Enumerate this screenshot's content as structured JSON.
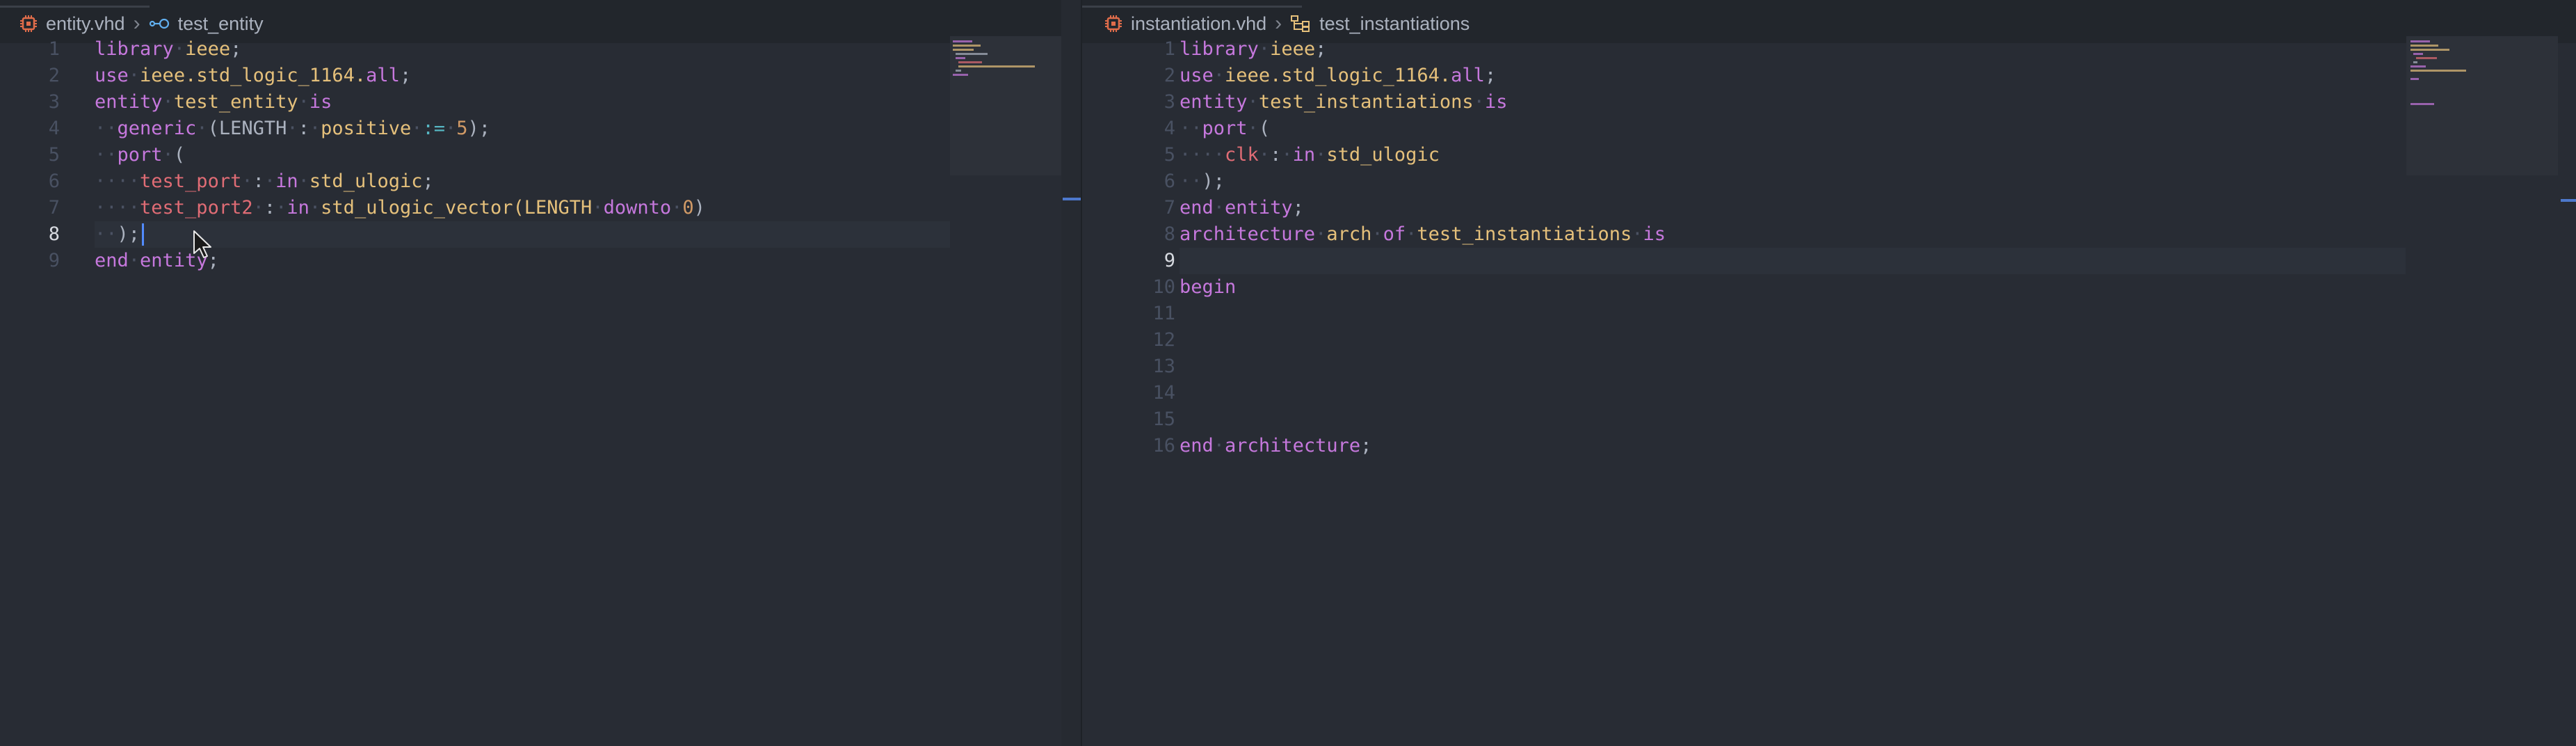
{
  "left_pane": {
    "breadcrumb": {
      "file": "entity.vhd",
      "symbol": "test_entity"
    },
    "line_numbers": [
      "1",
      "2",
      "3",
      "4",
      "5",
      "6",
      "7",
      "8",
      "9"
    ],
    "active_line": "8",
    "lines": [
      [
        {
          "t": "library",
          "c": "kw"
        },
        {
          "t": "·",
          "c": "ws"
        },
        {
          "t": "ieee",
          "c": "id"
        },
        {
          "t": ";",
          "c": ""
        }
      ],
      [
        {
          "t": "use",
          "c": "kw"
        },
        {
          "t": "·",
          "c": "ws"
        },
        {
          "t": "ieee.std_logic_1164.",
          "c": "id"
        },
        {
          "t": "all",
          "c": "kw"
        },
        {
          "t": ";",
          "c": ""
        }
      ],
      [
        {
          "t": "entity",
          "c": "kw"
        },
        {
          "t": "·",
          "c": "ws"
        },
        {
          "t": "test_entity",
          "c": "id"
        },
        {
          "t": "·",
          "c": "ws"
        },
        {
          "t": "is",
          "c": "kw"
        }
      ],
      [
        {
          "t": "··",
          "c": "ws"
        },
        {
          "t": "generic",
          "c": "kw"
        },
        {
          "t": "·",
          "c": "ws"
        },
        {
          "t": "(LENGTH",
          "c": ""
        },
        {
          "t": "·",
          "c": "ws"
        },
        {
          "t": ":",
          "c": ""
        },
        {
          "t": "·",
          "c": "ws"
        },
        {
          "t": "positive",
          "c": "id"
        },
        {
          "t": "·",
          "c": "ws"
        },
        {
          "t": ":=",
          "c": "op"
        },
        {
          "t": "·",
          "c": "ws"
        },
        {
          "t": "5",
          "c": "num"
        },
        {
          "t": ");",
          "c": ""
        }
      ],
      [
        {
          "t": "··",
          "c": "ws"
        },
        {
          "t": "port",
          "c": "kw"
        },
        {
          "t": "·",
          "c": "ws"
        },
        {
          "t": "(",
          "c": ""
        }
      ],
      [
        {
          "t": "····",
          "c": "ws"
        },
        {
          "t": "test_port",
          "c": "sg"
        },
        {
          "t": "·",
          "c": "ws"
        },
        {
          "t": ":",
          "c": ""
        },
        {
          "t": "·",
          "c": "ws"
        },
        {
          "t": "in",
          "c": "kw"
        },
        {
          "t": "·",
          "c": "ws"
        },
        {
          "t": "std_ulogic",
          "c": "id"
        },
        {
          "t": ";",
          "c": ""
        }
      ],
      [
        {
          "t": "····",
          "c": "ws"
        },
        {
          "t": "test_port2",
          "c": "sg"
        },
        {
          "t": "·",
          "c": "ws"
        },
        {
          "t": ":",
          "c": ""
        },
        {
          "t": "·",
          "c": "ws"
        },
        {
          "t": "in",
          "c": "kw"
        },
        {
          "t": "·",
          "c": "ws"
        },
        {
          "t": "std_ulogic_vector(LENGTH",
          "c": "id"
        },
        {
          "t": "·",
          "c": "ws"
        },
        {
          "t": "downto",
          "c": "kw"
        },
        {
          "t": "·",
          "c": "ws"
        },
        {
          "t": "0",
          "c": "num"
        },
        {
          "t": ")",
          "c": ""
        }
      ],
      [
        {
          "t": "··",
          "c": "ws"
        },
        {
          "t": ");",
          "c": ""
        }
      ],
      [
        {
          "t": "end",
          "c": "kw"
        },
        {
          "t": "·",
          "c": "ws"
        },
        {
          "t": "entity",
          "c": "kw"
        },
        {
          "t": ";",
          "c": ""
        }
      ]
    ]
  },
  "right_pane": {
    "breadcrumb": {
      "file": "instantiation.vhd",
      "symbol": "test_instantiations"
    },
    "line_numbers": [
      "1",
      "2",
      "3",
      "4",
      "5",
      "6",
      "7",
      "8",
      "9",
      "10",
      "11",
      "12",
      "13",
      "14",
      "15",
      "16"
    ],
    "active_line": "9",
    "lines": [
      [
        {
          "t": "library",
          "c": "kw"
        },
        {
          "t": "·",
          "c": "ws"
        },
        {
          "t": "ieee",
          "c": "id"
        },
        {
          "t": ";",
          "c": ""
        }
      ],
      [
        {
          "t": "use",
          "c": "kw"
        },
        {
          "t": "·",
          "c": "ws"
        },
        {
          "t": "ieee.std_logic_1164.",
          "c": "id"
        },
        {
          "t": "all",
          "c": "kw"
        },
        {
          "t": ";",
          "c": ""
        }
      ],
      [
        {
          "t": "entity",
          "c": "kw"
        },
        {
          "t": "·",
          "c": "ws"
        },
        {
          "t": "test_instantiations",
          "c": "id"
        },
        {
          "t": "·",
          "c": "ws"
        },
        {
          "t": "is",
          "c": "kw"
        }
      ],
      [
        {
          "t": "··",
          "c": "ws"
        },
        {
          "t": "port",
          "c": "kw"
        },
        {
          "t": "·",
          "c": "ws"
        },
        {
          "t": "(",
          "c": ""
        }
      ],
      [
        {
          "t": "····",
          "c": "ws"
        },
        {
          "t": "clk",
          "c": "sg"
        },
        {
          "t": "·",
          "c": "ws"
        },
        {
          "t": ":",
          "c": ""
        },
        {
          "t": "·",
          "c": "ws"
        },
        {
          "t": "in",
          "c": "kw"
        },
        {
          "t": "·",
          "c": "ws"
        },
        {
          "t": "std_ulogic",
          "c": "id"
        }
      ],
      [
        {
          "t": "··",
          "c": "ws"
        },
        {
          "t": ");",
          "c": ""
        }
      ],
      [
        {
          "t": "end",
          "c": "kw"
        },
        {
          "t": "·",
          "c": "ws"
        },
        {
          "t": "entity",
          "c": "kw"
        },
        {
          "t": ";",
          "c": ""
        }
      ],
      [
        {
          "t": "architecture",
          "c": "kw"
        },
        {
          "t": "·",
          "c": "ws"
        },
        {
          "t": "arch",
          "c": "id"
        },
        {
          "t": "·",
          "c": "ws"
        },
        {
          "t": "of",
          "c": "kw"
        },
        {
          "t": "·",
          "c": "ws"
        },
        {
          "t": "test_instantiations",
          "c": "id"
        },
        {
          "t": "·",
          "c": "ws"
        },
        {
          "t": "is",
          "c": "kw"
        }
      ],
      [],
      [
        {
          "t": "begin",
          "c": "kw"
        }
      ],
      [],
      [],
      [],
      [],
      [],
      [
        {
          "t": "end",
          "c": "kw"
        },
        {
          "t": "·",
          "c": "ws"
        },
        {
          "t": "architecture",
          "c": "kw"
        },
        {
          "t": ";",
          "c": ""
        }
      ]
    ]
  },
  "colors": {
    "background": "#282c34",
    "keyword": "#c678dd",
    "identifier": "#e5c07b",
    "signal": "#e06c75",
    "number": "#d19a66",
    "cursor": "#528bff"
  }
}
